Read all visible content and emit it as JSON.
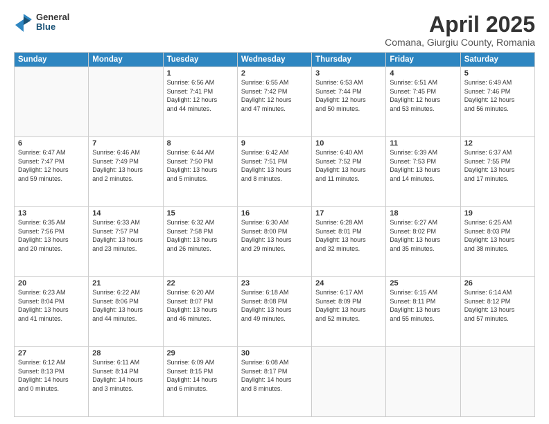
{
  "logo": {
    "general": "General",
    "blue": "Blue"
  },
  "title": "April 2025",
  "subtitle": "Comana, Giurgiu County, Romania",
  "days_of_week": [
    "Sunday",
    "Monday",
    "Tuesday",
    "Wednesday",
    "Thursday",
    "Friday",
    "Saturday"
  ],
  "weeks": [
    [
      {
        "day": "",
        "detail": ""
      },
      {
        "day": "",
        "detail": ""
      },
      {
        "day": "1",
        "detail": "Sunrise: 6:56 AM\nSunset: 7:41 PM\nDaylight: 12 hours\nand 44 minutes."
      },
      {
        "day": "2",
        "detail": "Sunrise: 6:55 AM\nSunset: 7:42 PM\nDaylight: 12 hours\nand 47 minutes."
      },
      {
        "day": "3",
        "detail": "Sunrise: 6:53 AM\nSunset: 7:44 PM\nDaylight: 12 hours\nand 50 minutes."
      },
      {
        "day": "4",
        "detail": "Sunrise: 6:51 AM\nSunset: 7:45 PM\nDaylight: 12 hours\nand 53 minutes."
      },
      {
        "day": "5",
        "detail": "Sunrise: 6:49 AM\nSunset: 7:46 PM\nDaylight: 12 hours\nand 56 minutes."
      }
    ],
    [
      {
        "day": "6",
        "detail": "Sunrise: 6:47 AM\nSunset: 7:47 PM\nDaylight: 12 hours\nand 59 minutes."
      },
      {
        "day": "7",
        "detail": "Sunrise: 6:46 AM\nSunset: 7:49 PM\nDaylight: 13 hours\nand 2 minutes."
      },
      {
        "day": "8",
        "detail": "Sunrise: 6:44 AM\nSunset: 7:50 PM\nDaylight: 13 hours\nand 5 minutes."
      },
      {
        "day": "9",
        "detail": "Sunrise: 6:42 AM\nSunset: 7:51 PM\nDaylight: 13 hours\nand 8 minutes."
      },
      {
        "day": "10",
        "detail": "Sunrise: 6:40 AM\nSunset: 7:52 PM\nDaylight: 13 hours\nand 11 minutes."
      },
      {
        "day": "11",
        "detail": "Sunrise: 6:39 AM\nSunset: 7:53 PM\nDaylight: 13 hours\nand 14 minutes."
      },
      {
        "day": "12",
        "detail": "Sunrise: 6:37 AM\nSunset: 7:55 PM\nDaylight: 13 hours\nand 17 minutes."
      }
    ],
    [
      {
        "day": "13",
        "detail": "Sunrise: 6:35 AM\nSunset: 7:56 PM\nDaylight: 13 hours\nand 20 minutes."
      },
      {
        "day": "14",
        "detail": "Sunrise: 6:33 AM\nSunset: 7:57 PM\nDaylight: 13 hours\nand 23 minutes."
      },
      {
        "day": "15",
        "detail": "Sunrise: 6:32 AM\nSunset: 7:58 PM\nDaylight: 13 hours\nand 26 minutes."
      },
      {
        "day": "16",
        "detail": "Sunrise: 6:30 AM\nSunset: 8:00 PM\nDaylight: 13 hours\nand 29 minutes."
      },
      {
        "day": "17",
        "detail": "Sunrise: 6:28 AM\nSunset: 8:01 PM\nDaylight: 13 hours\nand 32 minutes."
      },
      {
        "day": "18",
        "detail": "Sunrise: 6:27 AM\nSunset: 8:02 PM\nDaylight: 13 hours\nand 35 minutes."
      },
      {
        "day": "19",
        "detail": "Sunrise: 6:25 AM\nSunset: 8:03 PM\nDaylight: 13 hours\nand 38 minutes."
      }
    ],
    [
      {
        "day": "20",
        "detail": "Sunrise: 6:23 AM\nSunset: 8:04 PM\nDaylight: 13 hours\nand 41 minutes."
      },
      {
        "day": "21",
        "detail": "Sunrise: 6:22 AM\nSunset: 8:06 PM\nDaylight: 13 hours\nand 44 minutes."
      },
      {
        "day": "22",
        "detail": "Sunrise: 6:20 AM\nSunset: 8:07 PM\nDaylight: 13 hours\nand 46 minutes."
      },
      {
        "day": "23",
        "detail": "Sunrise: 6:18 AM\nSunset: 8:08 PM\nDaylight: 13 hours\nand 49 minutes."
      },
      {
        "day": "24",
        "detail": "Sunrise: 6:17 AM\nSunset: 8:09 PM\nDaylight: 13 hours\nand 52 minutes."
      },
      {
        "day": "25",
        "detail": "Sunrise: 6:15 AM\nSunset: 8:11 PM\nDaylight: 13 hours\nand 55 minutes."
      },
      {
        "day": "26",
        "detail": "Sunrise: 6:14 AM\nSunset: 8:12 PM\nDaylight: 13 hours\nand 57 minutes."
      }
    ],
    [
      {
        "day": "27",
        "detail": "Sunrise: 6:12 AM\nSunset: 8:13 PM\nDaylight: 14 hours\nand 0 minutes."
      },
      {
        "day": "28",
        "detail": "Sunrise: 6:11 AM\nSunset: 8:14 PM\nDaylight: 14 hours\nand 3 minutes."
      },
      {
        "day": "29",
        "detail": "Sunrise: 6:09 AM\nSunset: 8:15 PM\nDaylight: 14 hours\nand 6 minutes."
      },
      {
        "day": "30",
        "detail": "Sunrise: 6:08 AM\nSunset: 8:17 PM\nDaylight: 14 hours\nand 8 minutes."
      },
      {
        "day": "",
        "detail": ""
      },
      {
        "day": "",
        "detail": ""
      },
      {
        "day": "",
        "detail": ""
      }
    ]
  ]
}
